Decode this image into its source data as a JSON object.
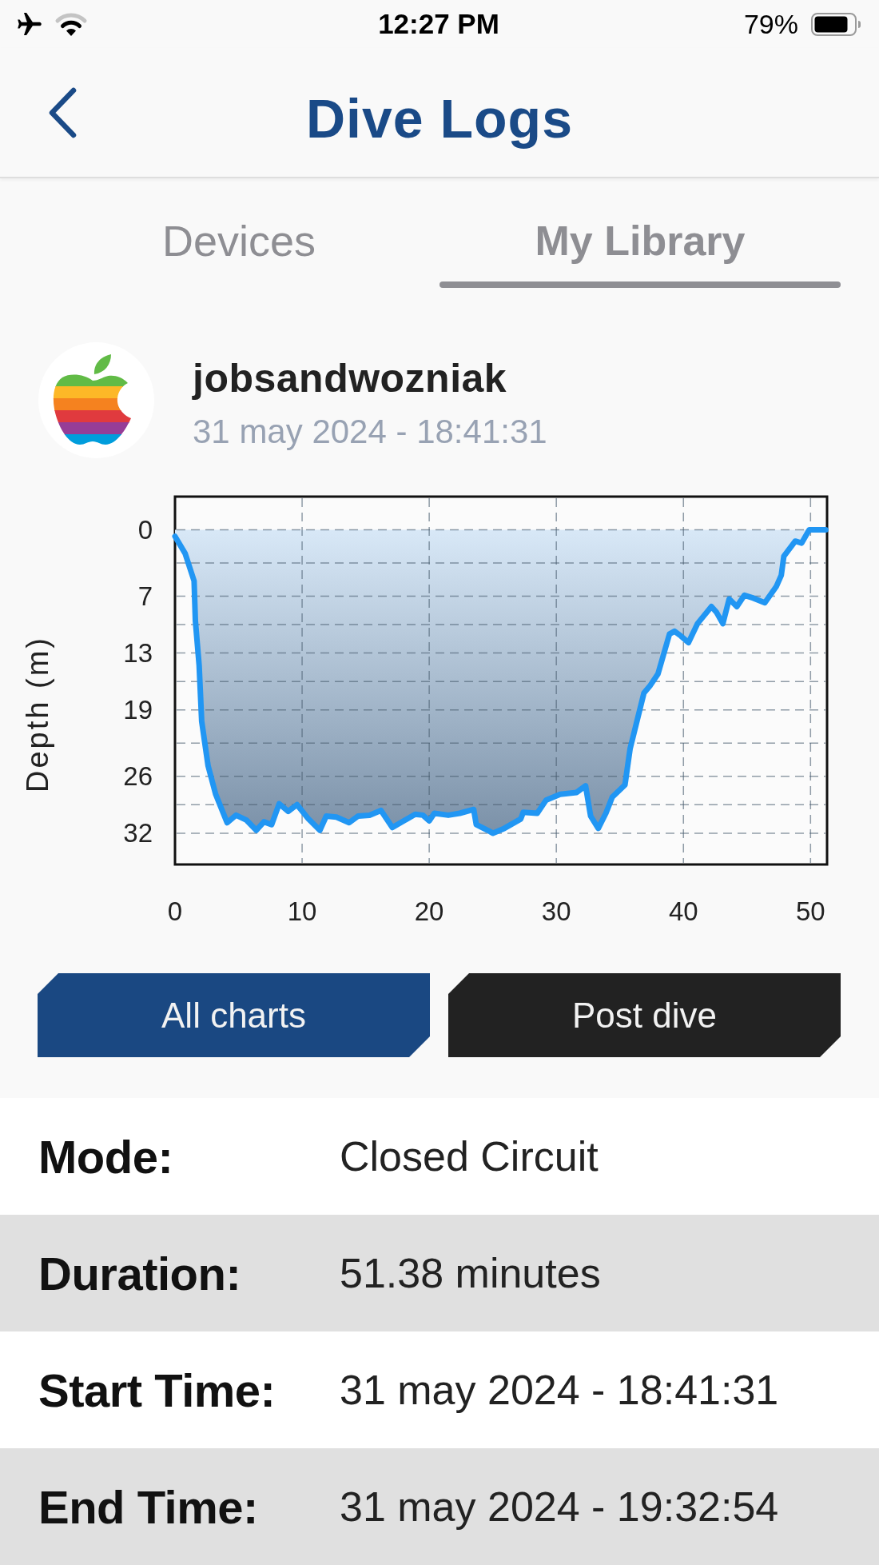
{
  "status_bar": {
    "time": "12:27 PM",
    "battery": "79%"
  },
  "header": {
    "title": "Dive Logs"
  },
  "tabs": [
    {
      "label": "Devices",
      "selected": false
    },
    {
      "label": "My Library",
      "selected": true
    }
  ],
  "profile": {
    "name": "jobsandwozniak",
    "date": "31 may 2024 - 18:41:31"
  },
  "dive_chart": {
    "chart_data": {
      "type": "area",
      "ylabel": "Depth (m)",
      "x": [
        0,
        0.8,
        1.5,
        1.6,
        1.9,
        2.1,
        2.6,
        3.2,
        4.1,
        4.8,
        5.6,
        6.4,
        7.0,
        7.6,
        8.2,
        8.9,
        9.6,
        10.5,
        11.4,
        11.9,
        12.7,
        13.7,
        14.4,
        15.3,
        16.2,
        17.1,
        18.9,
        19.5,
        20.0,
        20.4,
        21.5,
        22.4,
        23.5,
        23.7,
        24.6,
        25.0,
        25.9,
        27.2,
        27.4,
        28.5,
        29.2,
        30.3,
        31.6,
        32.3,
        32.7,
        33.3,
        33.9,
        34.4,
        35.4,
        35.8,
        36.9,
        37.4,
        38.0,
        38.9,
        39.3,
        39.8,
        40.4,
        41.1,
        42.2,
        42.6,
        43.1,
        43.6,
        44.2,
        44.8,
        45.5,
        46.4,
        47.3,
        47.7,
        47.9,
        48.8,
        49.3,
        49.9,
        50.6,
        51.2
      ],
      "series": [
        {
          "color": "#2196f3",
          "values": [
            0.7,
            2.5,
            5.4,
            9.6,
            14.3,
            20.2,
            24.9,
            27.9,
            30.9,
            30.1,
            30.6,
            31.7,
            30.8,
            31.1,
            28.9,
            29.7,
            29.0,
            30.5,
            31.7,
            30.2,
            30.3,
            30.9,
            30.2,
            30.1,
            29.6,
            31.4,
            30.0,
            30.1,
            30.7,
            29.9,
            30.1,
            29.9,
            29.5,
            31.1,
            31.7,
            32.0,
            31.5,
            30.5,
            29.8,
            29.9,
            28.5,
            27.9,
            27.7,
            27.0,
            30.2,
            31.5,
            29.9,
            28.2,
            26.9,
            23.1,
            17.2,
            16.4,
            15.2,
            11.0,
            10.7,
            11.2,
            11.9,
            9.9,
            8.1,
            8.7,
            9.9,
            7.3,
            8.1,
            6.9,
            7.2,
            7.7,
            6.0,
            4.8,
            2.8,
            1.2,
            1.4,
            0.0,
            0.0,
            0.0
          ]
        }
      ],
      "xlim": [
        0,
        51.3
      ],
      "ylim": [
        35.3,
        -3.5
      ],
      "xticks": [
        0,
        10,
        20,
        30,
        40,
        50
      ],
      "yticks": [
        0,
        7,
        13,
        19,
        26,
        32
      ],
      "grid": true
    }
  },
  "actions": [
    {
      "label": "All charts",
      "kind": "primary"
    },
    {
      "label": "Post dive",
      "kind": "dark"
    }
  ],
  "details": [
    {
      "label": "Mode:",
      "value": "Closed Circuit"
    },
    {
      "label": "Duration:",
      "value": "51.38 minutes"
    },
    {
      "label": "Start Time:",
      "value": "31 may 2024 - 18:41:31"
    },
    {
      "label": "End Time:",
      "value": "31 may 2024 - 19:32:54"
    }
  ]
}
